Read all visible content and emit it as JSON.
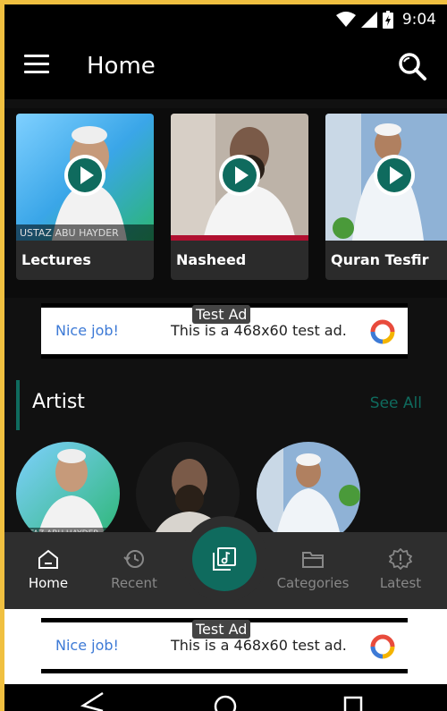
{
  "status": {
    "time": "9:04"
  },
  "appbar": {
    "title": "Home"
  },
  "categories": [
    {
      "label": "Lectures",
      "thumb_caption": "USTAZ ABU HAYDER"
    },
    {
      "label": "Nasheed"
    },
    {
      "label": "Quran Tesfir"
    }
  ],
  "ad_top": {
    "tag": "Test Ad",
    "left": "Nice job!",
    "text": "This is a 468x60 test ad."
  },
  "artist_section": {
    "title": "Artist",
    "see_all": "See All"
  },
  "artists": [
    {
      "caption": "ZTAZ ABU HAYDER"
    },
    {
      "caption": ""
    },
    {
      "caption": ""
    }
  ],
  "nav": {
    "items": [
      {
        "label": "Home",
        "icon": "home-icon"
      },
      {
        "label": "Recent",
        "icon": "history-icon"
      },
      {
        "label": "Categories",
        "icon": "folder-icon"
      },
      {
        "label": "Latest",
        "icon": "alert-icon"
      }
    ],
    "fab_icon": "music-library-icon"
  },
  "ad_bottom": {
    "tag": "Test Ad",
    "left": "Nice job!",
    "text": "This is a 468x60 test ad."
  },
  "colors": {
    "accent": "#0f6b5e",
    "frame": "#f0c040",
    "nav_bg": "#2e2e2e"
  }
}
